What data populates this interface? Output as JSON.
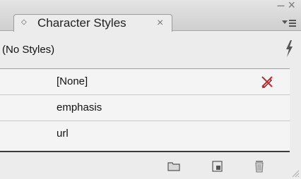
{
  "panel": {
    "tab_toggle_icon": "◇",
    "tab_title": "Character Styles",
    "tab_close_glyph": "×",
    "window_buttons": "– ×",
    "current_style": "(No Styles)"
  },
  "styles": {
    "items": [
      {
        "label": "[None]",
        "editable": false
      },
      {
        "label": "emphasis",
        "editable": true
      },
      {
        "label": "url",
        "editable": true
      }
    ]
  },
  "icons": {
    "flyout": "panel-menu-icon",
    "quick_apply": "lightning-bolt-icon",
    "not_editable": "pencil-crossed-icon",
    "new_group": "folder-icon",
    "new_style": "new-page-icon",
    "delete": "trash-icon"
  },
  "colors": {
    "panel_bg": "#ececec",
    "list_bg": "#f4f4f4",
    "cross_red": "#d02020"
  }
}
